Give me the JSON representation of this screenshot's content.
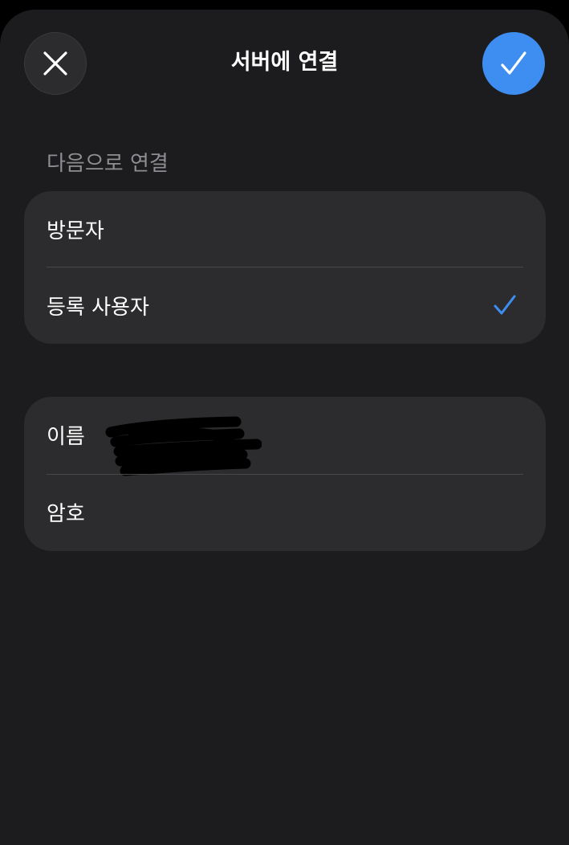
{
  "header": {
    "title": "서버에 연결",
    "close_icon": "close-icon",
    "confirm_icon": "checkmark-icon"
  },
  "connect_as": {
    "section_label": "다음으로 연결",
    "options": [
      {
        "label": "방문자",
        "selected": false
      },
      {
        "label": "등록 사용자",
        "selected": true
      }
    ]
  },
  "credentials": {
    "name_label": "이름",
    "name_value_redacted": true,
    "password_label": "암호"
  },
  "colors": {
    "background": "#1c1c1e",
    "group_background": "#2c2c2e",
    "accent": "#3d8ef0",
    "secondary_text": "#8e8e93"
  }
}
